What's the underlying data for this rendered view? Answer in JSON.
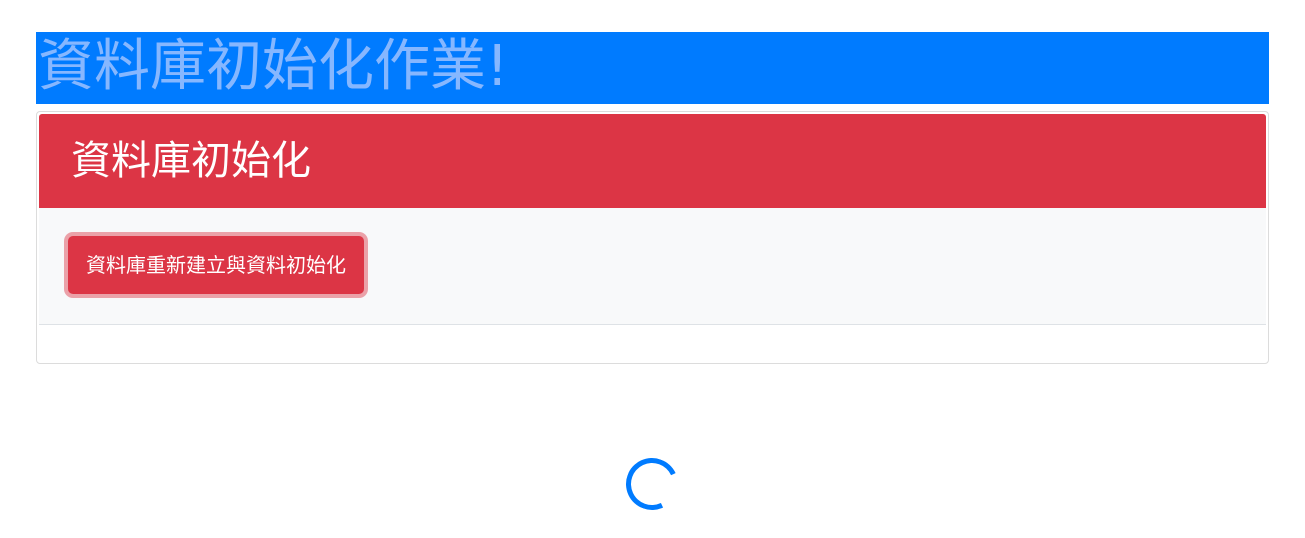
{
  "page": {
    "banner_title": "資料庫初始化作業!"
  },
  "card": {
    "header_title": "資料庫初始化",
    "reset_button_label": "資料庫重新建立與資料初始化"
  },
  "loading": {
    "icon": "loading-spinner-icon",
    "color": "#007bff"
  },
  "colors": {
    "primary": "#007bff",
    "danger": "#dc3545",
    "body_background": "#f8f9fa"
  }
}
